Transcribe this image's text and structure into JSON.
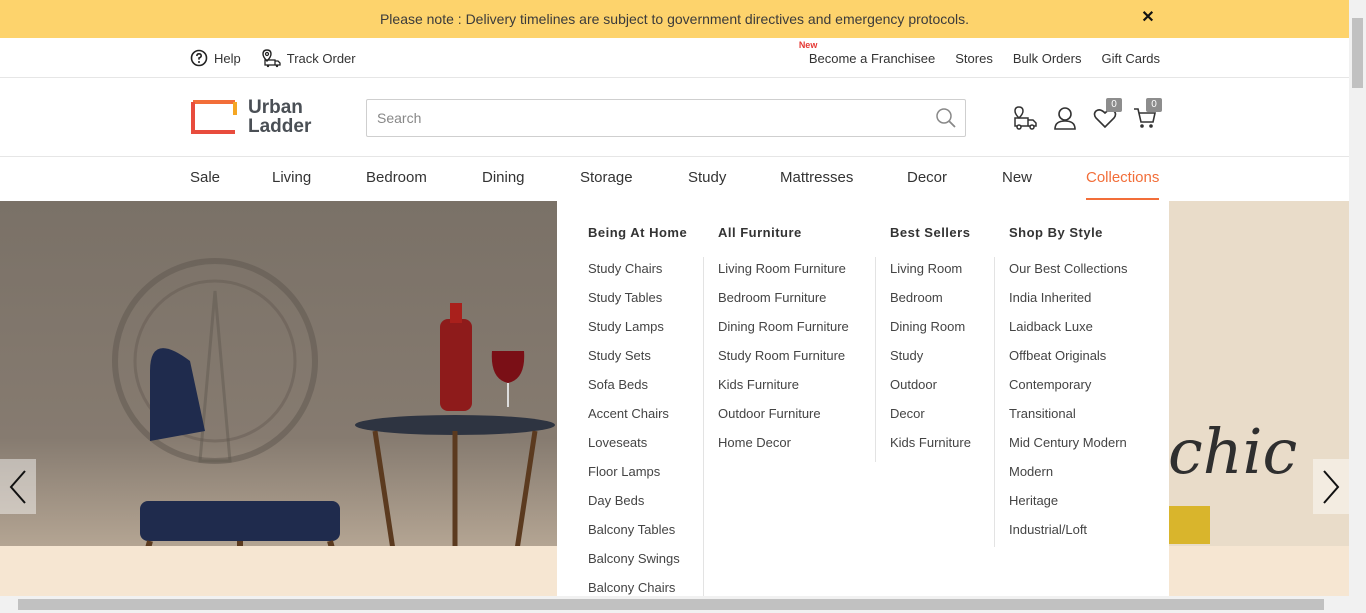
{
  "notice": {
    "text": "Please note : Delivery timelines are subject to government directives and emergency protocols.",
    "close": "✕"
  },
  "utility": {
    "help": "Help",
    "track_order": "Track Order",
    "new_tag": "New",
    "franchise": "Become a Franchisee",
    "stores": "Stores",
    "bulk_orders": "Bulk Orders",
    "gift_cards": "Gift Cards"
  },
  "header": {
    "logo_line1": "Urban",
    "logo_line2": "Ladder",
    "search_placeholder": "Search",
    "wishlist_count": "0",
    "cart_count": "0"
  },
  "nav": [
    "Sale",
    "Living",
    "Bedroom",
    "Dining",
    "Storage",
    "Study",
    "Mattresses",
    "Decor",
    "New",
    "Collections"
  ],
  "mega_menu": {
    "columns": [
      {
        "title": "Being At Home",
        "items": [
          "Study Chairs",
          "Study Tables",
          "Study Lamps",
          "Study Sets",
          "Sofa Beds",
          "Accent Chairs",
          "Loveseats",
          "Floor Lamps",
          "Day Beds",
          "Balcony Tables",
          "Balcony Swings",
          "Balcony Chairs"
        ]
      },
      {
        "title": "All Furniture",
        "items": [
          "Living Room Furniture",
          "Bedroom Furniture",
          "Dining Room Furniture",
          "Study Room Furniture",
          "Kids Furniture",
          "Outdoor Furniture",
          "Home Decor"
        ]
      },
      {
        "title": "Best Sellers",
        "items": [
          "Living Room",
          "Bedroom",
          "Dining Room",
          "Study",
          "Outdoor",
          "Decor",
          "Kids Furniture"
        ]
      },
      {
        "title": "Shop By Style",
        "items": [
          "Our Best Collections",
          "India Inherited",
          "Laidback Luxe",
          "Offbeat Originals",
          "Contemporary",
          "Transitional",
          "Mid Century Modern",
          "Modern",
          "Heritage",
          "Industrial/Loft"
        ]
      }
    ]
  },
  "hero": {
    "text": "chic"
  },
  "colors": {
    "accent": "#f26e39",
    "notice_bg": "#fdd36c"
  }
}
